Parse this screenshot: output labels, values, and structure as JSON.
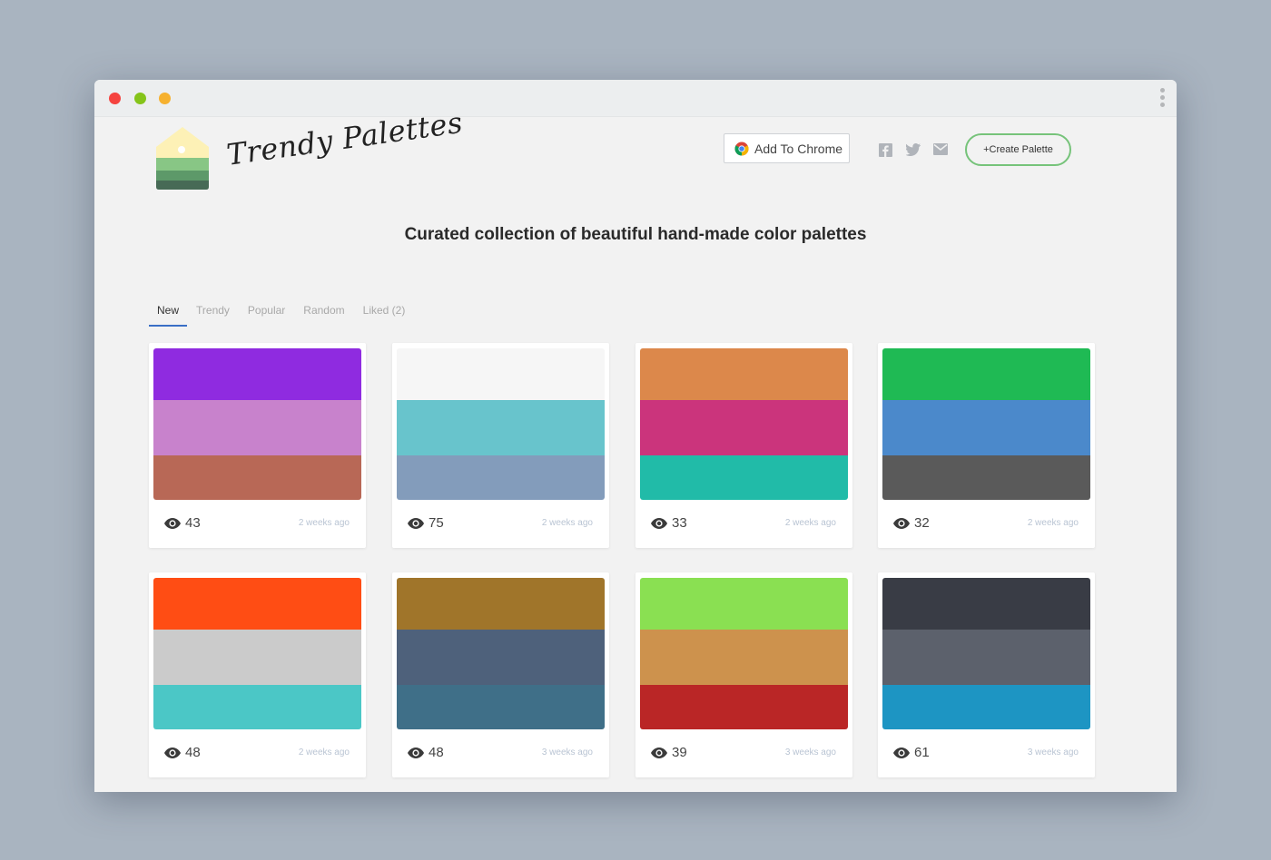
{
  "app": {
    "brand": "Trendy Palettes",
    "headline": "Curated collection of beautiful hand-made color palettes"
  },
  "header": {
    "chrome_button": "Add To Chrome",
    "create_button": "+Create Palette",
    "social_icons": [
      "facebook-icon",
      "twitter-icon",
      "mail-icon"
    ]
  },
  "tabs": [
    {
      "label": "New",
      "active": true
    },
    {
      "label": "Trendy",
      "active": false
    },
    {
      "label": "Popular",
      "active": false
    },
    {
      "label": "Random",
      "active": false
    },
    {
      "label": "Liked (2)",
      "active": false
    }
  ],
  "palettes": [
    {
      "views": "43",
      "ago": "2 weeks ago",
      "colors": [
        "#8f2be0",
        "#c882cc",
        "#b86856"
      ]
    },
    {
      "views": "75",
      "ago": "2 weeks ago",
      "colors": [
        "#f6f6f6",
        "#68c4cc",
        "#839cbb"
      ]
    },
    {
      "views": "33",
      "ago": "2 weeks ago",
      "colors": [
        "#dc884b",
        "#cb347c",
        "#21bba8"
      ]
    },
    {
      "views": "32",
      "ago": "2 weeks ago",
      "colors": [
        "#1fba54",
        "#4b89cb",
        "#5a5a5a"
      ]
    },
    {
      "views": "48",
      "ago": "2 weeks ago",
      "colors": [
        "#ff4d14",
        "#cbcbcb",
        "#4bc7c6"
      ]
    },
    {
      "views": "48",
      "ago": "3 weeks ago",
      "colors": [
        "#a0752a",
        "#4e617b",
        "#3f6f88"
      ]
    },
    {
      "views": "39",
      "ago": "3 weeks ago",
      "colors": [
        "#8ae052",
        "#cd924d",
        "#ba2626"
      ]
    },
    {
      "views": "61",
      "ago": "3 weeks ago",
      "colors": [
        "#393c45",
        "#5c616c",
        "#1d95c3"
      ]
    }
  ]
}
